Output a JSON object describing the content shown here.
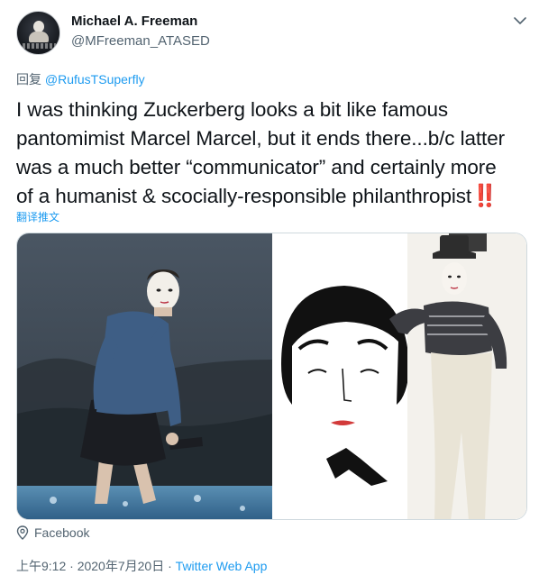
{
  "author": {
    "name": "Michael A. Freeman",
    "handle": "@MFreeman_ATASED"
  },
  "reply": {
    "label": "回复",
    "to": "@RufusTSuperfly"
  },
  "tweet": {
    "line1": "I was thinking Zuckerberg looks a bit like famous",
    "line2": "pantomimist Marcel Marcel, but it ends there...b/c latter",
    "line3": "was a much better “communicator” and certainly more",
    "line4": "of a humanist & scocially-responsible philanthropist",
    "emoji": "‼️"
  },
  "translate_label": "翻译推文",
  "media": {
    "left_alt": "Man in blue shirt and black shorts on rocky shore with face replaced by mime makeup",
    "right_alt": "Mime drawing and photo of performer in striped shirt, white pants and top hat"
  },
  "source": {
    "icon": "location-pin-icon",
    "label": "Facebook"
  },
  "meta": {
    "time": "上午9:12",
    "date": "2020年7月20日",
    "separator": "·",
    "app": "Twitter Web App"
  },
  "colors": {
    "accent": "#1d9bf0",
    "secondary_text": "#536471",
    "primary_text": "#0f1419"
  }
}
